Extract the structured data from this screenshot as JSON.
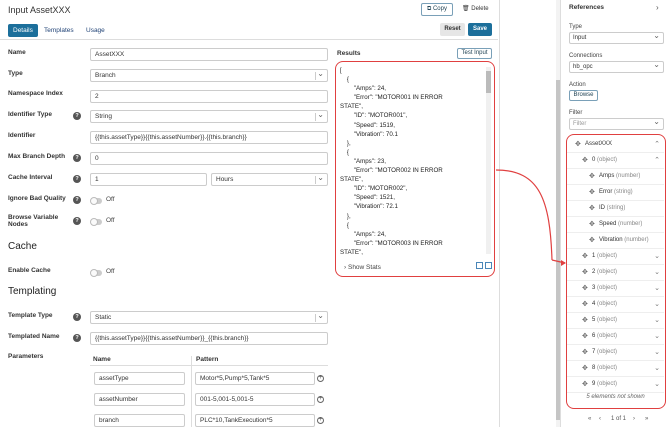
{
  "header": {
    "title": "Input AssetXXX",
    "copy_label": "Copy",
    "delete_label": "Delete"
  },
  "tabs": [
    {
      "label": "Details"
    },
    {
      "label": "Templates"
    },
    {
      "label": "Usage"
    }
  ],
  "actions": {
    "reset_label": "Reset",
    "save_label": "Save"
  },
  "form": {
    "name_label": "Name",
    "name_value": "AssetXXX",
    "type_label": "Type",
    "type_value": "Branch",
    "ns_label": "Namespace Index",
    "ns_value": "2",
    "idtype_label": "Identifier Type",
    "idtype_value": "String",
    "identifier_label": "Identifier",
    "identifier_value": "{{this.assetType}}{{this.assetNumber}}.{{this.branch}}",
    "maxdepth_label": "Max Branch Depth",
    "maxdepth_value": "0",
    "cache_label": "Cache Interval",
    "cache_value": "1",
    "cache_unit": "Hours",
    "ignore_label": "Ignore Bad Quality",
    "ignore_value": "Off",
    "browse_label_1": "Browse Variable",
    "browse_label_2": "Nodes",
    "browse_value": "Off"
  },
  "cache_section": {
    "title": "Cache",
    "enable_label": "Enable Cache",
    "enable_value": "Off"
  },
  "templating": {
    "title": "Templating",
    "ttype_label": "Template Type",
    "ttype_value": "Static",
    "tname_label": "Templated Name",
    "tname_value": "{{this.assetType}}{{this.assetNumber}}_{{this.branch}}",
    "params_label": "Parameters",
    "col_name": "Name",
    "col_pattern": "Pattern",
    "rows": [
      {
        "name": "assetType",
        "pattern": "Motor*5,Pump*5,Tank*5"
      },
      {
        "name": "assetNumber",
        "pattern": "001-5,001-5,001-5"
      },
      {
        "name": "branch",
        "pattern": "PLC*10,TankExecution*5"
      }
    ]
  },
  "results": {
    "label": "Results",
    "test_label": "Test Input",
    "show_stats": "Show Stats",
    "code_lines": [
      "[",
      "    {",
      "        \"Amps\": 24,",
      "        \"Error\": \"MOTOR001 IN ERROR",
      "STATE\",",
      "        \"ID\": \"MOTOR001\",",
      "        \"Speed\": 1519,",
      "        \"Vibration\": 70.1",
      "    },",
      "    {",
      "        \"Amps\": 23,",
      "        \"Error\": \"MOTOR002 IN ERROR",
      "STATE\",",
      "        \"ID\": \"MOTOR002\",",
      "        \"Speed\": 1521,",
      "        \"Vibration\": 72.1",
      "    },",
      "    {",
      "        \"Amps\": 24,",
      "        \"Error\": \"MOTOR003 IN ERROR",
      "STATE\","
    ]
  },
  "references": {
    "title": "References",
    "type_label": "Type",
    "type_value": "Input",
    "conn_label": "Connections",
    "conn_value": "hb_opc",
    "action_label": "Action",
    "browse_label": "Browse",
    "filter_label": "Filter",
    "filter_placeholder": "Filter",
    "tree": [
      {
        "name": "AssetXXX",
        "type": "",
        "indent": 0,
        "chev": "⌃"
      },
      {
        "name": "0",
        "type": "(object)",
        "indent": 1,
        "chev": "⌃"
      },
      {
        "name": "Amps",
        "type": "(number)",
        "indent": 2,
        "chev": ""
      },
      {
        "name": "Error",
        "type": "(string)",
        "indent": 2,
        "chev": ""
      },
      {
        "name": "ID",
        "type": "(string)",
        "indent": 2,
        "chev": ""
      },
      {
        "name": "Speed",
        "type": "(number)",
        "indent": 2,
        "chev": ""
      },
      {
        "name": "Vibration",
        "type": "(number)",
        "indent": 2,
        "chev": ""
      },
      {
        "name": "1",
        "type": "(object)",
        "indent": 1,
        "chev": "⌄"
      },
      {
        "name": "2",
        "type": "(object)",
        "indent": 1,
        "chev": "⌄"
      },
      {
        "name": "3",
        "type": "(object)",
        "indent": 1,
        "chev": "⌄"
      },
      {
        "name": "4",
        "type": "(object)",
        "indent": 1,
        "chev": "⌄"
      },
      {
        "name": "5",
        "type": "(object)",
        "indent": 1,
        "chev": "⌄"
      },
      {
        "name": "6",
        "type": "(object)",
        "indent": 1,
        "chev": "⌄"
      },
      {
        "name": "7",
        "type": "(object)",
        "indent": 1,
        "chev": "⌄"
      },
      {
        "name": "8",
        "type": "(object)",
        "indent": 1,
        "chev": "⌄"
      },
      {
        "name": "9",
        "type": "(object)",
        "indent": 1,
        "chev": "⌄"
      }
    ],
    "not_shown": "5 elements not shown",
    "pager": "1 of 1"
  },
  "colors": {
    "accent": "#1c6f9b",
    "highlight": "#e04040"
  }
}
